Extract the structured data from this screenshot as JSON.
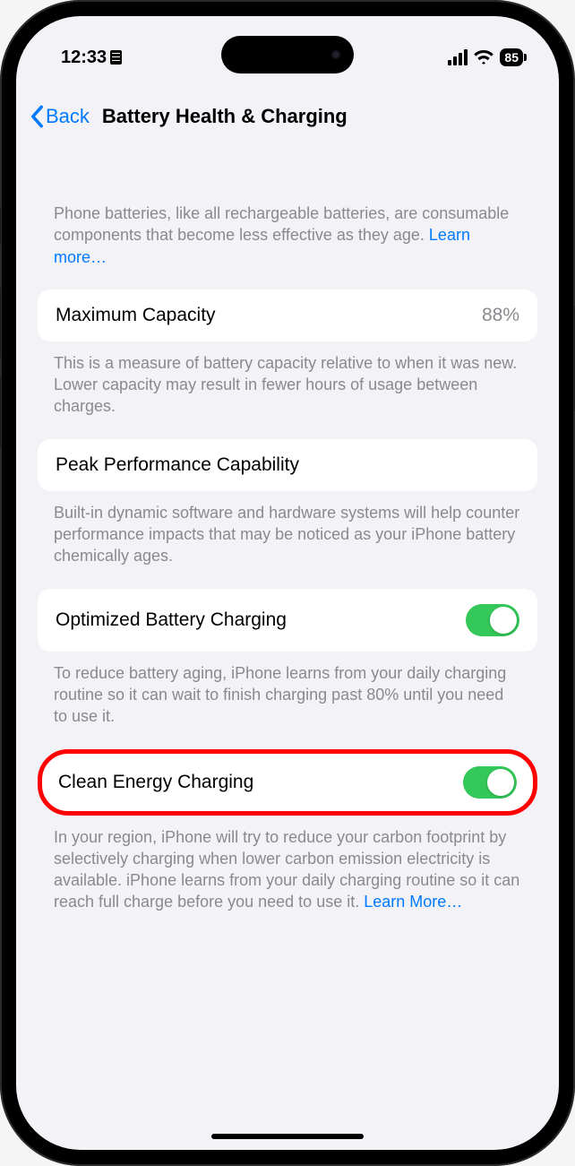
{
  "statusbar": {
    "time": "12:33",
    "battery_percent": "85"
  },
  "nav": {
    "back_label": "Back",
    "title": "Battery Health & Charging"
  },
  "intro": {
    "text": "Phone batteries, like all rechargeable batteries, are consumable components that become less effective as they age. ",
    "learn_more": "Learn more…"
  },
  "maximum_capacity": {
    "label": "Maximum Capacity",
    "value": "88%",
    "desc": "This is a measure of battery capacity relative to when it was new. Lower capacity may result in fewer hours of usage between charges."
  },
  "peak_performance": {
    "label": "Peak Performance Capability",
    "desc": "Built-in dynamic software and hardware systems will help counter performance impacts that may be noticed as your iPhone battery chemically ages."
  },
  "optimized_charging": {
    "label": "Optimized Battery Charging",
    "on": true,
    "desc": "To reduce battery aging, iPhone learns from your daily charging routine so it can wait to finish charging past 80% until you need to use it."
  },
  "clean_energy": {
    "label": "Clean Energy Charging",
    "on": true,
    "desc": "In your region, iPhone will try to reduce your carbon footprint by selectively charging when lower carbon emission electricity is available. iPhone learns from your daily charging routine so it can reach full charge before you need to use it. ",
    "learn_more": "Learn More…"
  }
}
